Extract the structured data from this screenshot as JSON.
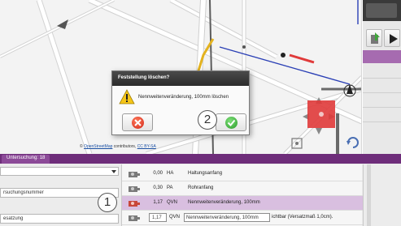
{
  "dialog": {
    "title": "Feststellung löschen?",
    "message": "Nennweitenveränderung, 100mm löschen",
    "icons": {
      "warning": "warning-icon",
      "cancel": "red-x-icon",
      "confirm": "green-check-icon"
    }
  },
  "map": {
    "attribution_prefix": "©",
    "attribution_link1": "OpenStreetMap",
    "attribution_middle": "contributors,",
    "attribution_link2": "CC BY-SA"
  },
  "callouts": {
    "one": "1",
    "two": "2"
  },
  "bottom": {
    "tab_label": "Untersuchung: 18",
    "fields": [
      {
        "text": "rsuchungsnummer"
      },
      {
        "text": "esatzung"
      }
    ],
    "rows": [
      {
        "value": "0,00",
        "code": "HA",
        "description": "Haltungsanfang",
        "selected": false
      },
      {
        "value": "0,30",
        "code": "PA",
        "description": "Rohranfang",
        "selected": false
      },
      {
        "value": "1,17",
        "code": "QVN",
        "description": "Nennweitenveränderung, 100mm",
        "selected": true
      }
    ],
    "edit_row": {
      "value": "1,17",
      "code": "QVN",
      "description": "Nennweitenveränderung, 100mm",
      "tail": "ichtbar (Versatzmaß 1,0cm)."
    }
  },
  "colors": {
    "accent_purple": "#6e2d7a",
    "selected_row": "#d9bfe0",
    "map_marker_red": "#e03a3a",
    "pipe_yellow": "#e3b21f"
  }
}
